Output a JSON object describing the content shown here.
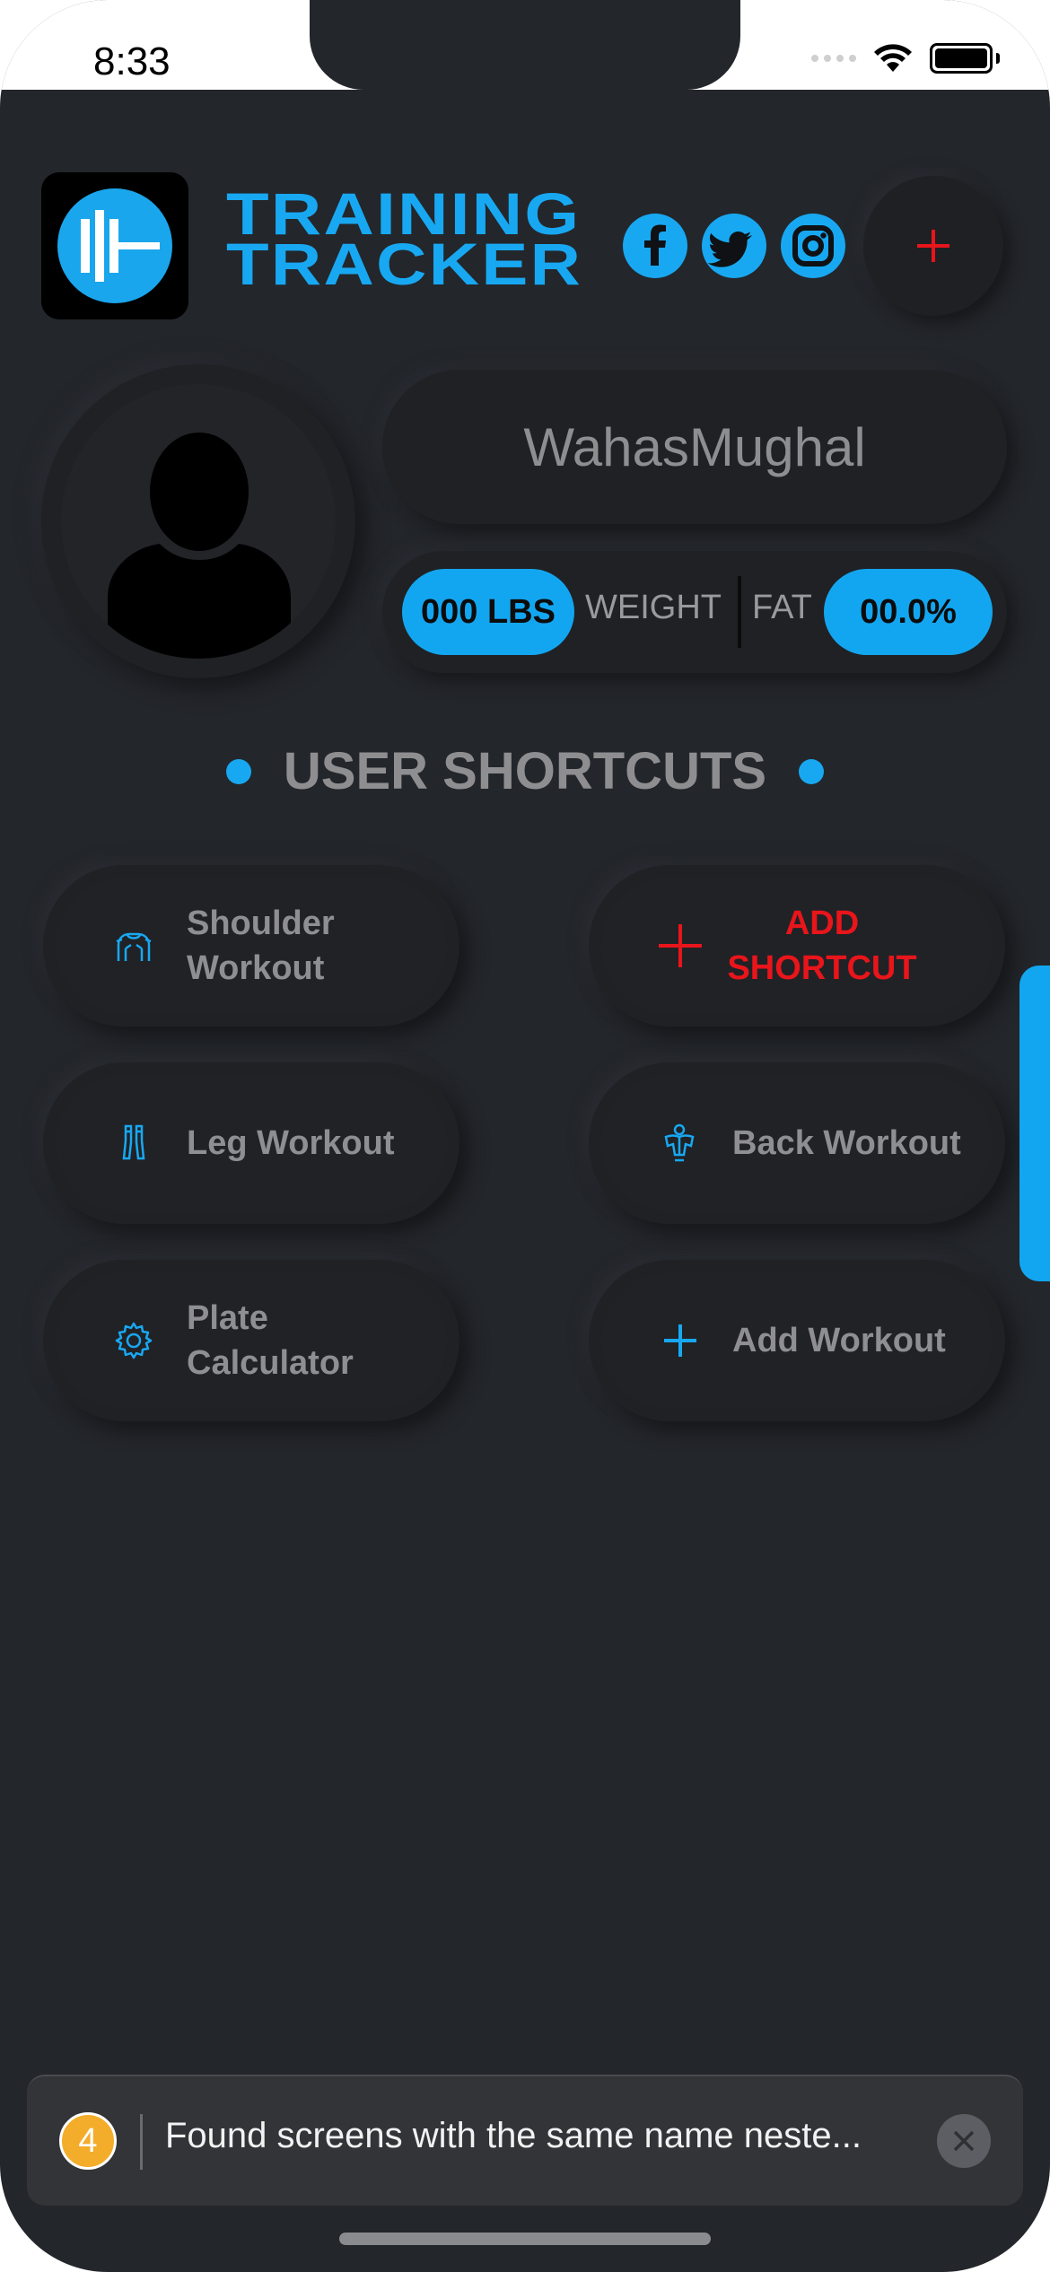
{
  "status_bar": {
    "time": "8:33"
  },
  "header": {
    "brand_line1": "TRAINING",
    "brand_line2": "TRACKER",
    "add_icon": "plus-icon",
    "social": [
      "facebook-icon",
      "twitter-icon",
      "instagram-icon"
    ]
  },
  "profile": {
    "username": "WahasMughal",
    "weight_value": "000 LBS",
    "weight_label": "WEIGHT",
    "fat_label": "FAT",
    "fat_value": "00.0%"
  },
  "shortcuts": {
    "title": "USER SHORTCUTS",
    "items": [
      {
        "line1": "Shoulder",
        "line2": "Workout",
        "icon": "shoulder-icon"
      },
      {
        "line1": "ADD",
        "line2": "SHORTCUT",
        "icon": "plus-icon"
      },
      {
        "line1": "Leg Workout",
        "line2": "",
        "icon": "legs-icon"
      },
      {
        "line1": "Back Workout",
        "line2": "",
        "icon": "back-icon"
      },
      {
        "line1": "Plate",
        "line2": "Calculator",
        "icon": "gear-icon"
      },
      {
        "line1": "Add Workout",
        "line2": "",
        "icon": "plus-icon"
      }
    ]
  },
  "toast": {
    "count": "4",
    "message": "Found screens with the same name neste..."
  },
  "colors": {
    "accent": "#18a8f2",
    "danger": "#e8151b",
    "background": "#23262b"
  }
}
